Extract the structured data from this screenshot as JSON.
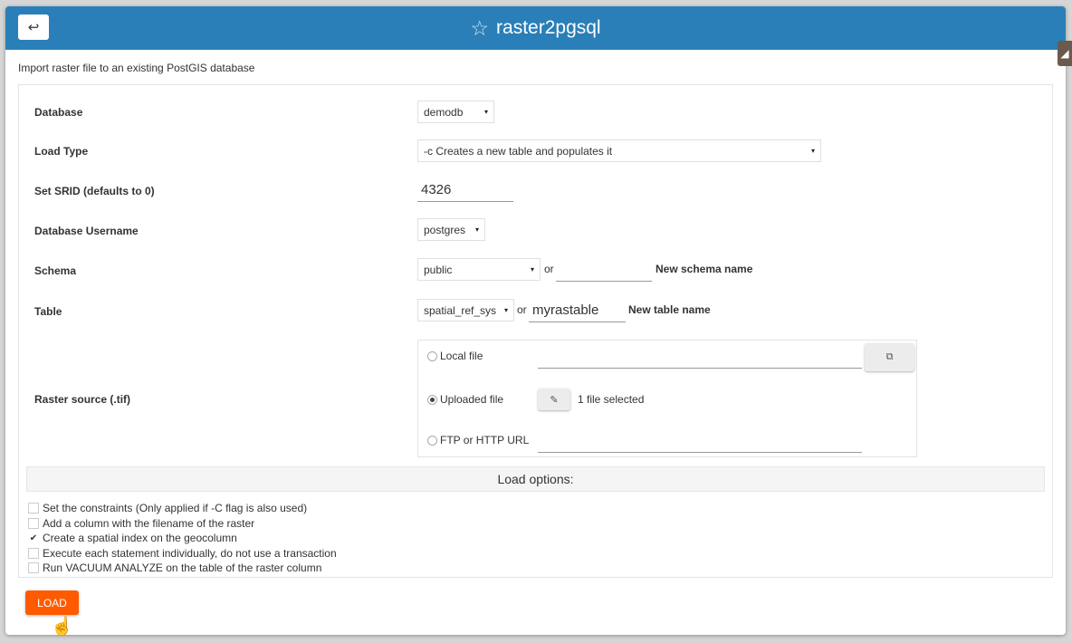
{
  "header": {
    "back_icon": "↩",
    "star_icon": "☆",
    "title": "raster2pgsql"
  },
  "subtitle": "Import raster file to an existing PostGIS database",
  "form": {
    "database": {
      "label": "Database",
      "value": "demodb"
    },
    "load_type": {
      "label": "Load Type",
      "value": "-c Creates a new table and populates it"
    },
    "srid": {
      "label": "Set SRID (defaults to 0)",
      "value": "4326"
    },
    "username": {
      "label": "Database Username",
      "value": "postgres"
    },
    "schema": {
      "label": "Schema",
      "value": "public",
      "or": "or",
      "new_value": "",
      "hint": "New schema name"
    },
    "table": {
      "label": "Table",
      "value": "spatial_ref_sys",
      "or": "or",
      "new_value": "myrastable",
      "hint": "New table name"
    },
    "raster_source": {
      "label": "Raster source (.tif)",
      "local_file": {
        "label": "Local file",
        "value": "",
        "selected": false
      },
      "uploaded_file": {
        "label": "Uploaded file",
        "status": "1 file selected",
        "selected": true
      },
      "url": {
        "label": "FTP or HTTP URL",
        "value": "",
        "selected": false
      }
    }
  },
  "load_options": {
    "title": "Load options:",
    "items": [
      {
        "label": "Set the constraints (Only applied if -C flag is also used)",
        "checked": false
      },
      {
        "label": "Add a column with the filename of the raster",
        "checked": false
      },
      {
        "label": "Create a spatial index on the geocolumn",
        "checked": true
      },
      {
        "label": "Execute each statement individually, do not use a transaction",
        "checked": false
      },
      {
        "label": "Run VACUUM ANALYZE on the table of the raster column",
        "checked": false
      }
    ]
  },
  "load_button": "LOAD",
  "icons": {
    "dropdown": "▾",
    "browse": "⧉",
    "attach": "✎",
    "check": "✔",
    "cursor": "☝"
  }
}
